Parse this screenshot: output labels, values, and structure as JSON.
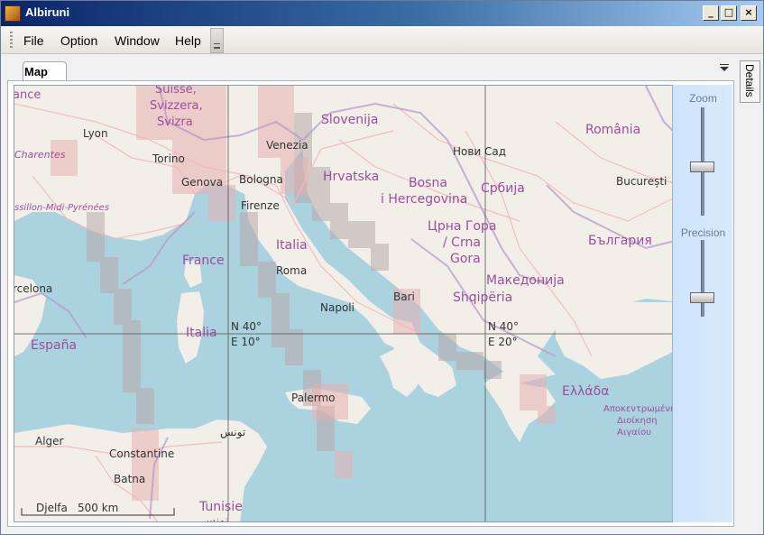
{
  "window": {
    "title": "Albiruni",
    "minimize_label": "_",
    "maximize_label": "□",
    "close_label": "×"
  },
  "menubar": {
    "items": [
      {
        "label": "File"
      },
      {
        "label": "Option"
      },
      {
        "label": "Window"
      },
      {
        "label": "Help"
      }
    ]
  },
  "tabs": [
    {
      "label": "Map"
    }
  ],
  "dock": {
    "details_label": "Details"
  },
  "sidepanel": {
    "zoom_label": "Zoom",
    "zoom_level": 0.45,
    "precision_label": "Precision",
    "precision_level": 0.25
  },
  "map": {
    "grid_labels": [
      {
        "lat": "N 40°",
        "lon": "E 10°"
      },
      {
        "lat": "N 40°",
        "lon": "E 20°"
      }
    ],
    "scale": {
      "left_label": "Djelfa",
      "distance": "500 km"
    },
    "places": {
      "france_top": "ance",
      "suisse": "Suisse,",
      "svizzera": "Svizzera,",
      "svizra": "Svizra",
      "lyon": "Lyon",
      "charentes": "Charentes",
      "torino": "Torino",
      "genova": "Genova",
      "midi": "ssillon-Midi-Pyrénées",
      "bologna": "Bologna",
      "venezia": "Venezia",
      "firenze": "Firenze",
      "slovenija": "Slovenija",
      "hrvatska": "Hrvatska",
      "novi_sad": "Нови Сад",
      "romania": "România",
      "bosna": "Bosna",
      "hercegovina": "i Hercegovina",
      "srbija": "Србија",
      "bucuresti": "București",
      "crna_gora": "Црна Гора",
      "crna_gora2": "/ Crna",
      "gora": "Gora",
      "bulgaria": "България",
      "italia_mainland": "Italia",
      "france": "France",
      "roma": "Roma",
      "barcelona": "rcelona",
      "napoli": "Napoli",
      "bari": "Bari",
      "makedonija": "Македонија",
      "shqiperia": "Shqipëria",
      "italia_sardinia": "Italia",
      "espana": "España",
      "ellada": "Ελλάδα",
      "aigaiou1": "Αποκεντρωμένη",
      "aigaiou2": "Διοίκηση",
      "aigaiou3": "Αιγαίου",
      "palermo": "Palermo",
      "tunis": "تونس",
      "alger": "Alger",
      "constantine": "Constantine",
      "batna": "Batna",
      "tunisie": "Tunisie",
      "tunisie_ar": "تونس"
    }
  },
  "colors": {
    "land": "#f2efe9",
    "sea": "#aad3df",
    "border": "#b89ac8",
    "road": "#f2b8b8",
    "highlight": "#e8b0b0",
    "grid_tile": "#b9a9a9"
  }
}
